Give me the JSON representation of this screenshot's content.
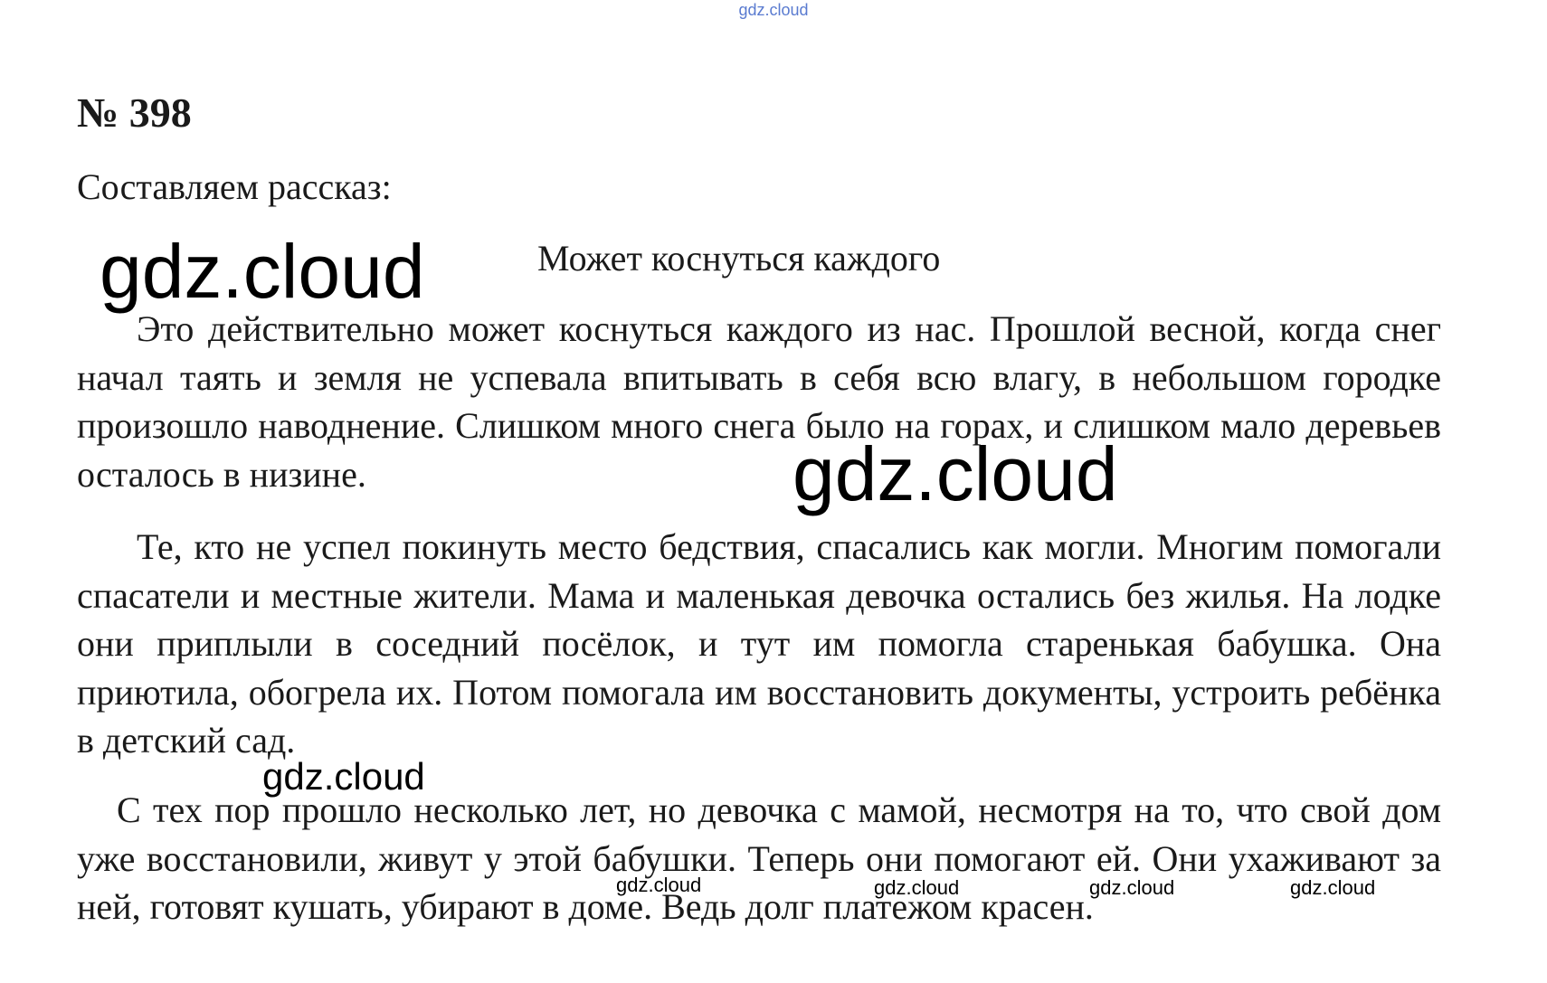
{
  "watermarks": {
    "top": "gdz.cloud",
    "big_1": "gdz.cloud",
    "big_2": "gdz.cloud",
    "middle": "gdz.cloud",
    "small": [
      "gdz.cloud",
      "gdz.cloud",
      "gdz.cloud",
      "gdz.cloud"
    ]
  },
  "task": {
    "number": "№ 398",
    "label": "Составляем рассказ:"
  },
  "story": {
    "title": "Может коснуться каждого",
    "paragraphs": [
      "Это действительно может коснуться каждого из нас. Прошлой весной, когда снег начал таять и земля не успевала впитывать в себя всю влагу, в небольшом городке произошло наводнение. Слишком много снега было на горах, и слишком мало деревьев осталось в низине.",
      "Те, кто не успел покинуть место бедствия, спасались как могли. Многим помогали спасатели и местные жители. Мама и маленькая девочка остались без жилья. На лодке они приплыли в соседний посёлок, и тут им помогла старенькая бабушка. Она приютила, обогрела их. Потом помогала им восстановить документы, устроить ребёнка в детский сад.",
      "С тех пор прошло несколько лет, но девочка с мамой, несмотря на то, что свой дом уже восстановили, живут у этой бабушки. Теперь они помогают ей. Они ухаживают за ней, готовят кушать, убирают в доме. Ведь долг платежом красен."
    ]
  }
}
